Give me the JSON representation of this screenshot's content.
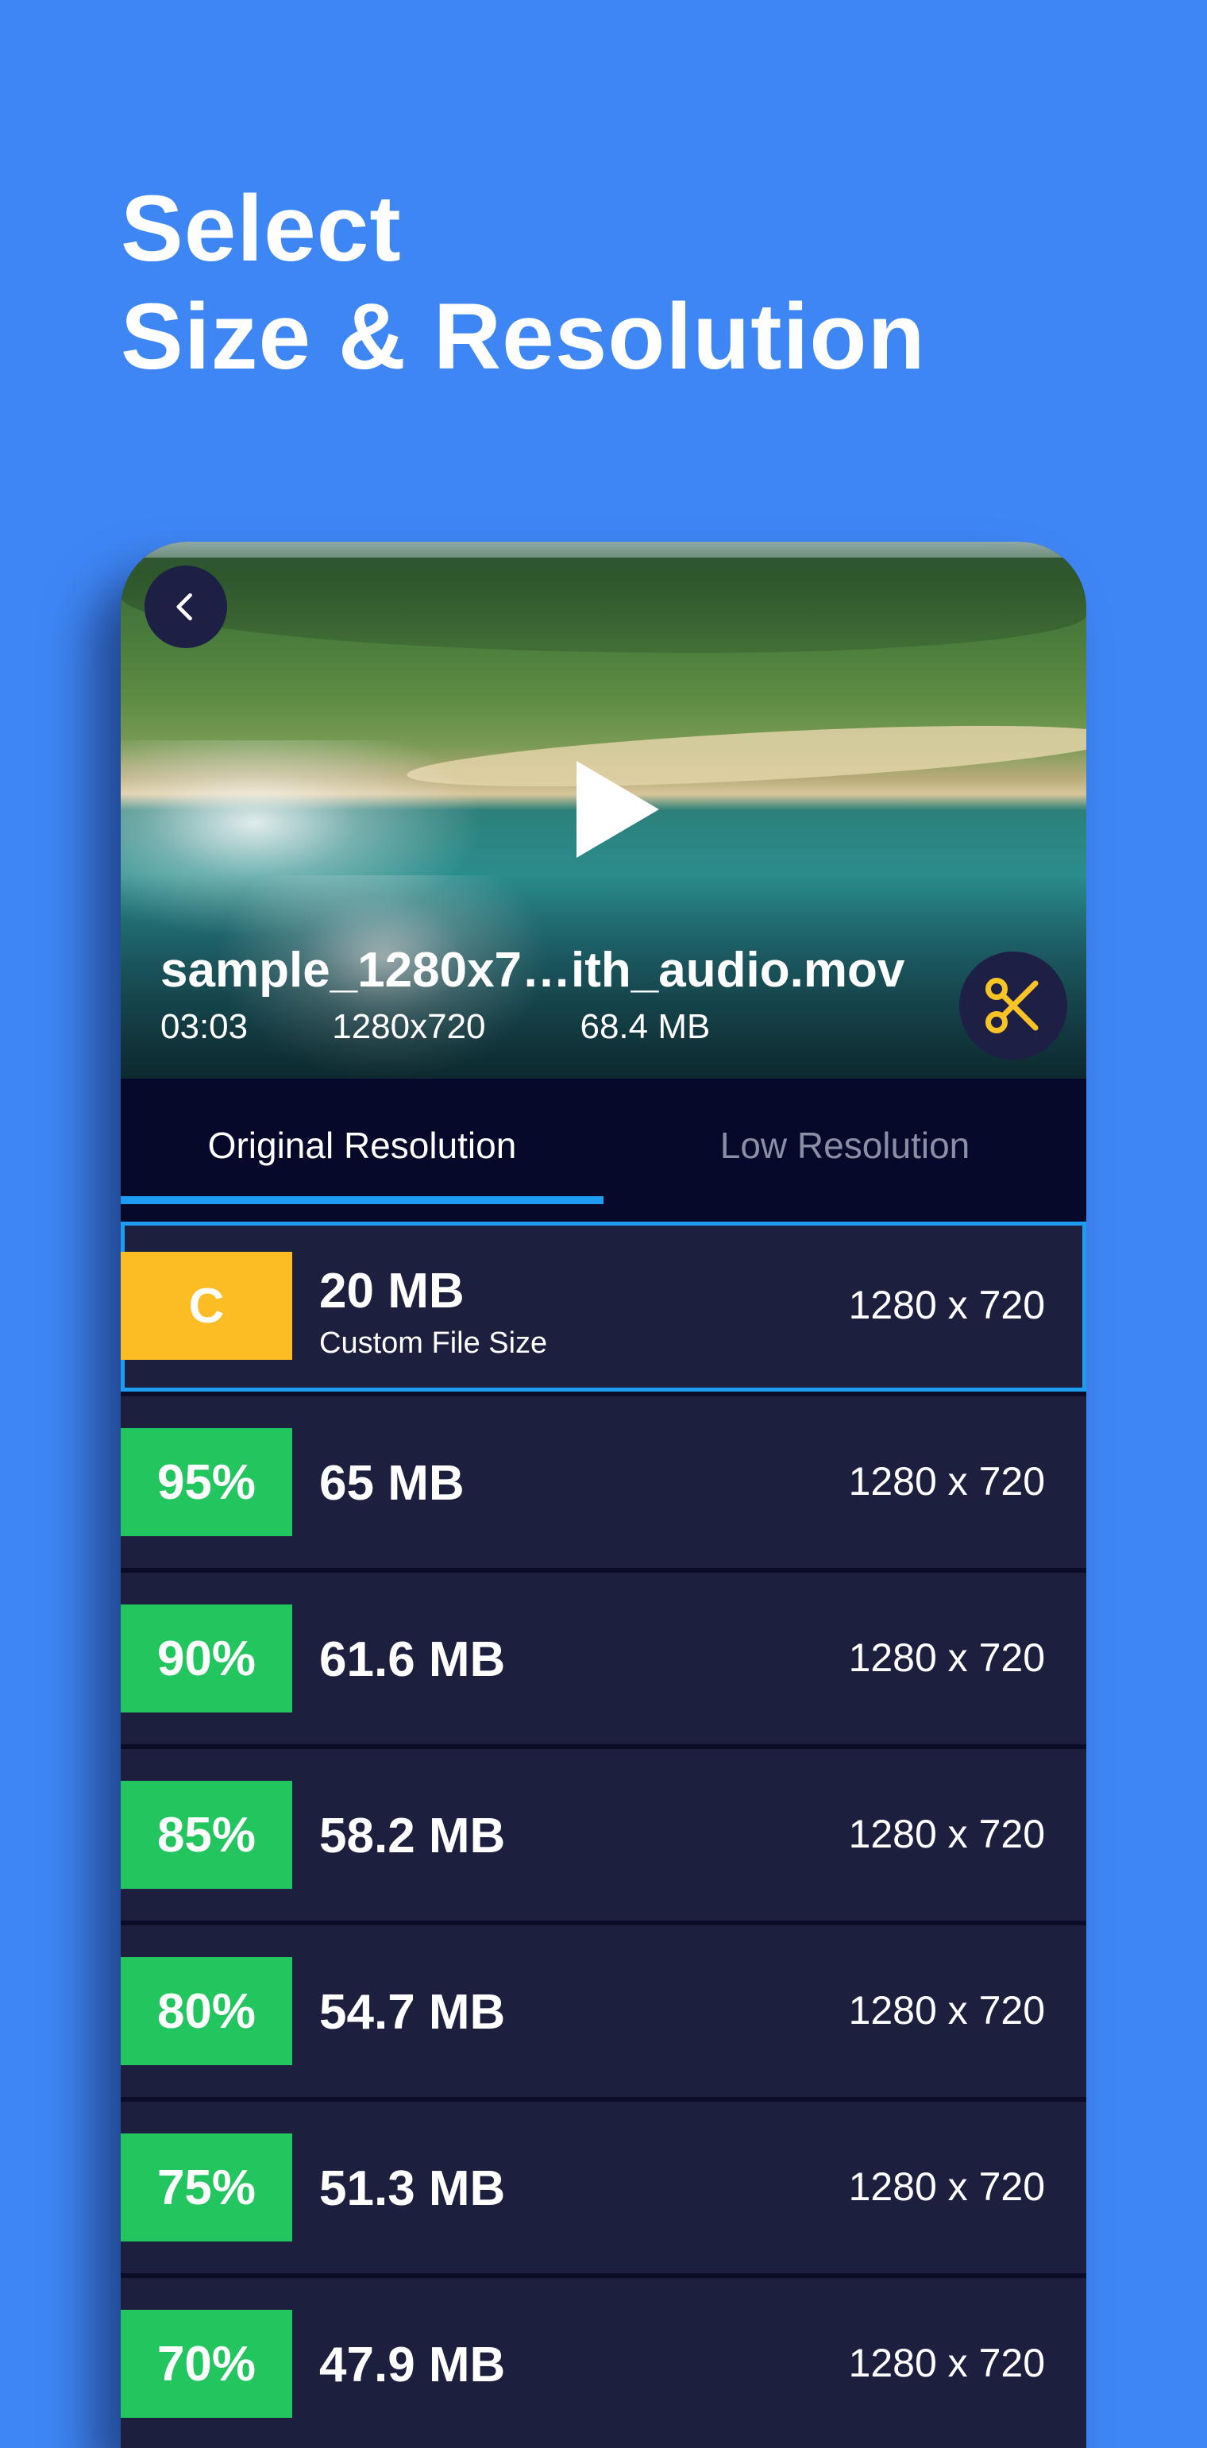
{
  "headline": {
    "line1": "Select",
    "line2": "Size & Resolution"
  },
  "video": {
    "file_name": "sample_1280x7…ith_audio.mov",
    "duration": "03:03",
    "dimensions": "1280x720",
    "file_size": "68.4 MB"
  },
  "icons": {
    "back": "chevron-left-icon",
    "play": "play-icon",
    "trim": "scissors-icon"
  },
  "tabs": [
    {
      "label": "Original Resolution",
      "active": true
    },
    {
      "label": "Low Resolution",
      "active": false
    }
  ],
  "options": [
    {
      "badge": "C",
      "size": "20 MB",
      "subtitle": "Custom File Size",
      "resolution": "1280 x 720",
      "badge_color": "#fbbd23",
      "selected": true
    },
    {
      "badge": "95%",
      "size": "65 MB",
      "resolution": "1280 x 720",
      "badge_color": "#22c55e"
    },
    {
      "badge": "90%",
      "size": "61.6 MB",
      "resolution": "1280 x 720",
      "badge_color": "#22c55e"
    },
    {
      "badge": "85%",
      "size": "58.2 MB",
      "resolution": "1280 x 720",
      "badge_color": "#22c55e"
    },
    {
      "badge": "80%",
      "size": "54.7 MB",
      "resolution": "1280 x 720",
      "badge_color": "#22c55e"
    },
    {
      "badge": "75%",
      "size": "51.3 MB",
      "resolution": "1280 x 720",
      "badge_color": "#22c55e"
    },
    {
      "badge": "70%",
      "size": "47.9 MB",
      "resolution": "1280 x 720",
      "badge_color": "#22c55e"
    }
  ],
  "colors": {
    "background": "#3f86f5",
    "panel": "#1c1f3d",
    "tab_bar": "#07092a",
    "accent": "#1e9cf0",
    "custom_badge": "#fbbd23",
    "percent_badge": "#22c55e",
    "trim_icon": "#f7c325"
  }
}
